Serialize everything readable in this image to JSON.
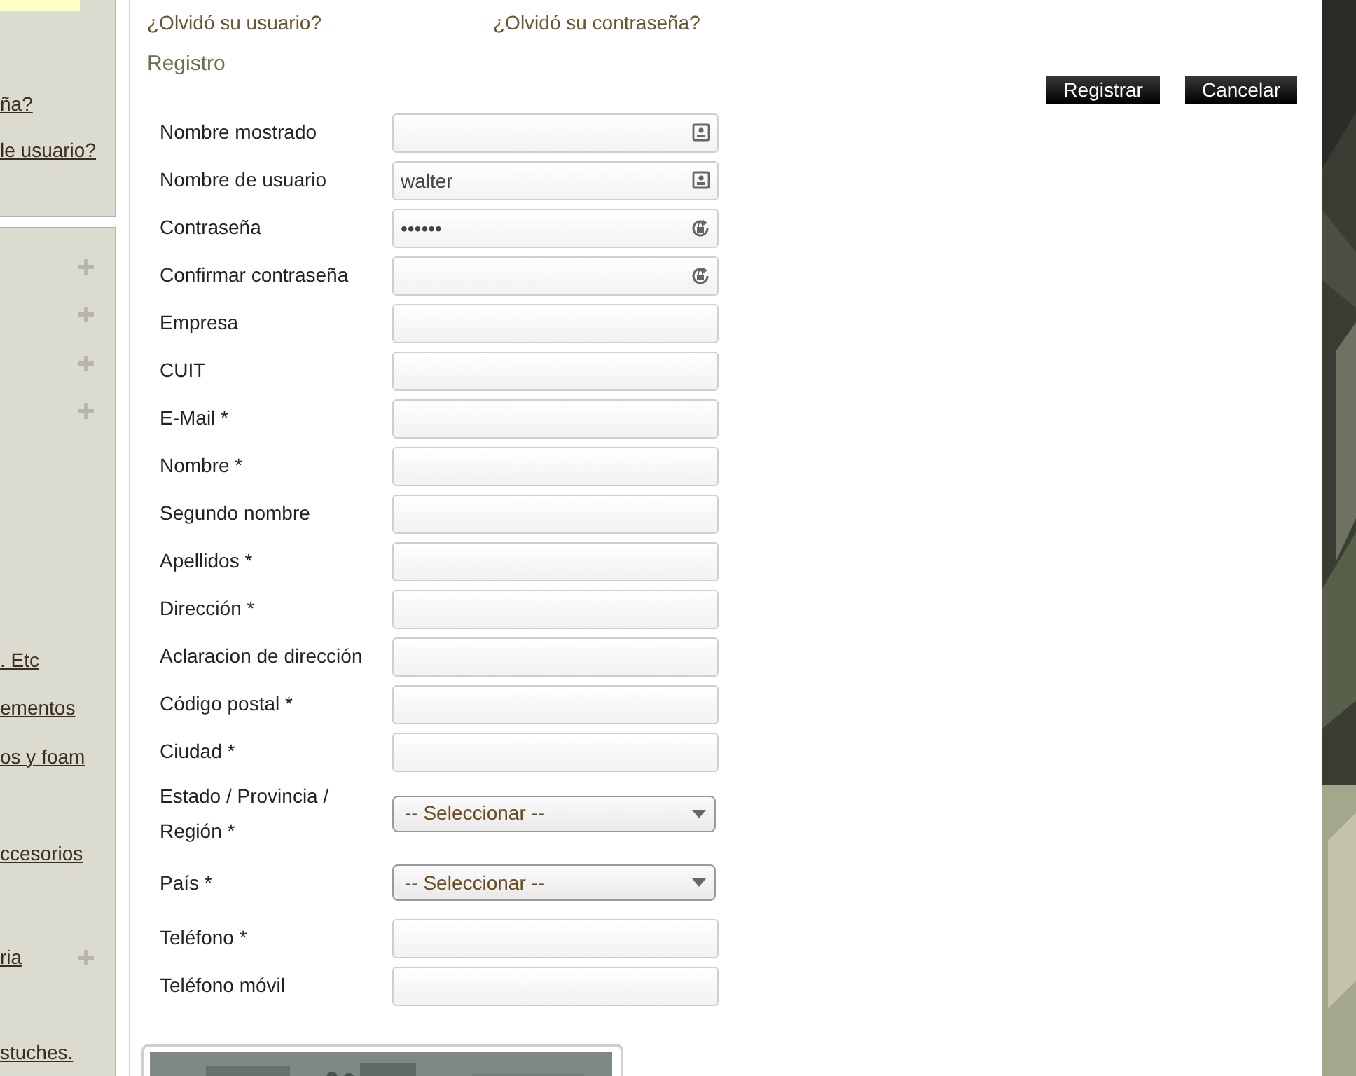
{
  "sidebar": {
    "login_links": [
      "ña?",
      "le usuario?"
    ],
    "menu": [
      {
        "expandable": true
      },
      {
        "expandable": true
      },
      {
        "expandable": true
      },
      {
        "expandable": true
      },
      {
        "label": ". Etc",
        "expandable": false
      },
      {
        "label": "ementos",
        "expandable": false
      },
      {
        "label": "os y foam",
        "expandable": false
      },
      {
        "label": "ccesorios",
        "expandable": false
      },
      {
        "label": "ria",
        "expandable": true
      },
      {
        "label": "stuches.",
        "expandable": false
      }
    ]
  },
  "top_links": [
    "¿Olvidó su usuario?",
    "¿Olvidó su contraseña?"
  ],
  "heading": "Registro",
  "buttons": [
    "Registrar",
    "Cancelar"
  ],
  "fields": [
    {
      "label": "Nombre mostrado",
      "kind": "user"
    },
    {
      "label": "Nombre de usuario",
      "kind": "user",
      "value": "walter"
    },
    {
      "label": "Contraseña",
      "kind": "password",
      "value": "••••••"
    },
    {
      "label": "Confirmar contraseña",
      "kind": "password"
    },
    {
      "label": "Empresa",
      "kind": "text"
    },
    {
      "label": "CUIT",
      "kind": "text"
    },
    {
      "label": "E-Mail *",
      "kind": "text"
    },
    {
      "label": "Nombre *",
      "kind": "text"
    },
    {
      "label": "Segundo nombre",
      "kind": "text"
    },
    {
      "label": "Apellidos *",
      "kind": "text"
    },
    {
      "label": "Dirección *",
      "kind": "text"
    },
    {
      "label": "Aclaracion de dirección",
      "kind": "text"
    },
    {
      "label": "Código postal *",
      "kind": "text"
    },
    {
      "label": "Ciudad *",
      "kind": "text"
    },
    {
      "label": "Estado / Provincia / Región *",
      "kind": "select",
      "value": "-- Seleccionar --"
    },
    {
      "label": "País *",
      "kind": "select",
      "value": "-- Seleccionar --"
    },
    {
      "label": "Teléfono *",
      "kind": "text"
    },
    {
      "label": "Teléfono móvil",
      "kind": "text"
    }
  ]
}
